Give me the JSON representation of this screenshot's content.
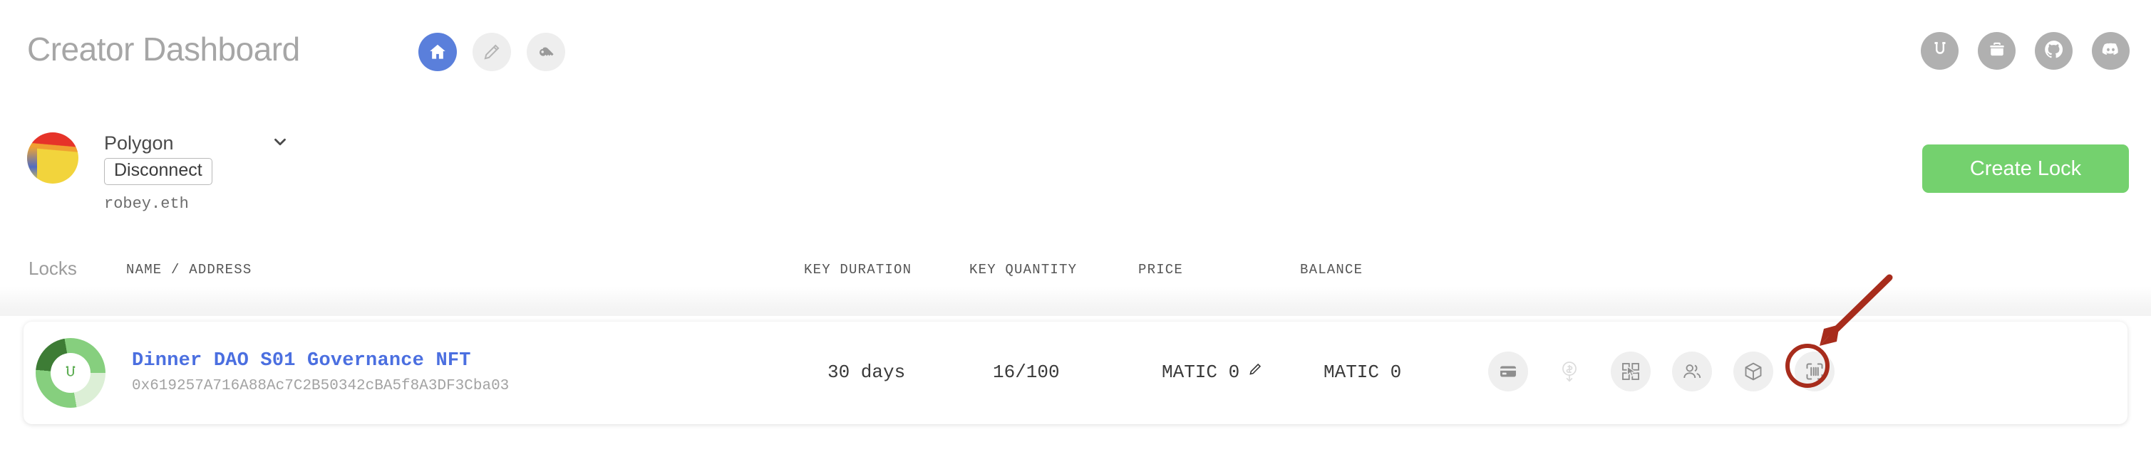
{
  "header": {
    "title": "Creator Dashboard",
    "nav": [
      {
        "name": "home",
        "icon": "home-icon",
        "active": true
      },
      {
        "name": "editor",
        "icon": "pencil-icon",
        "active": false
      },
      {
        "name": "keys",
        "icon": "key-icon",
        "active": false
      }
    ],
    "social": [
      {
        "name": "unlock",
        "icon": "unlock-logo-icon"
      },
      {
        "name": "jobs",
        "icon": "briefcase-icon"
      },
      {
        "name": "github",
        "icon": "github-icon"
      },
      {
        "name": "discord",
        "icon": "discord-icon"
      }
    ]
  },
  "account": {
    "network": "Polygon",
    "disconnect_label": "Disconnect",
    "ens_name": "robey.eth",
    "chevron_icon": "chevron-down-icon",
    "avatar_icon": "wallet-avatar"
  },
  "actions": {
    "create_lock_label": "Create Lock",
    "create_lock_color": "#74d16e"
  },
  "table": {
    "section_label": "Locks",
    "columns": [
      {
        "key": "name_address",
        "label": "NAME / ADDRESS"
      },
      {
        "key": "key_duration",
        "label": "KEY DURATION"
      },
      {
        "key": "key_quantity",
        "label": "KEY QUANTITY"
      },
      {
        "key": "price",
        "label": "PRICE"
      },
      {
        "key": "balance",
        "label": "BALANCE"
      }
    ],
    "rows": [
      {
        "name": "Dinner DAO S01 Governance NFT",
        "address": "0x619257A716A88Ac7C2B50342cBA5f8A3DF3Cba03",
        "key_duration": "30 days",
        "key_quantity": "16/100",
        "price": "MATIC 0",
        "balance": "MATIC 0",
        "name_color": "#4b6fe0",
        "row_actions": [
          {
            "name": "credit-card-icon",
            "label": "Credit card",
            "highlighted": false
          },
          {
            "name": "withdraw-icon",
            "label": "Withdraw",
            "highlighted": false,
            "muted": true
          },
          {
            "name": "demo-app-icon",
            "label": "Demo",
            "highlighted": false
          },
          {
            "name": "members-icon",
            "label": "Members",
            "highlighted": false
          },
          {
            "name": "explorer-cube-icon",
            "label": "Explorer",
            "highlighted": false
          },
          {
            "name": "barcode-scanner-icon",
            "label": "Scanner",
            "highlighted": true
          }
        ]
      }
    ]
  },
  "annotation": {
    "color": "#a72c1c",
    "target": "barcode-scanner-icon",
    "arrow_icon": "annotation-arrow-icon",
    "circle_icon": "annotation-circle-icon"
  }
}
